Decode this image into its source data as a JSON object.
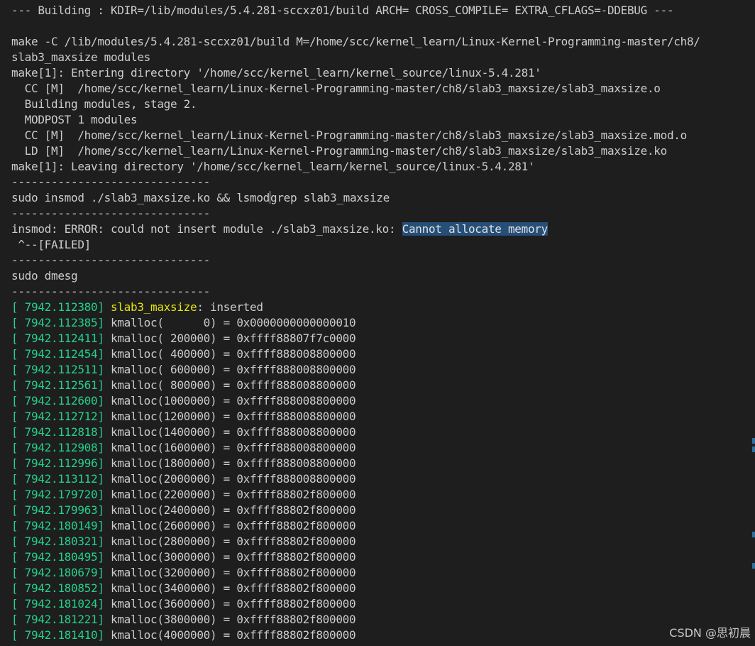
{
  "terminal": {
    "build_header": "--- Building : KDIR=/lib/modules/5.4.281-sccxz01/build ARCH= CROSS_COMPILE= EXTRA_CFLAGS=-DDEBUG ---",
    "make_cmd_1": "make -C /lib/modules/5.4.281-sccxz01/build M=/home/scc/kernel_learn/Linux-Kernel-Programming-master/ch8/",
    "make_cmd_2": "slab3_maxsize modules",
    "make_enter": "make[1]: Entering directory '/home/scc/kernel_learn/kernel_source/linux-5.4.281'",
    "cc_1": "  CC [M]  /home/scc/kernel_learn/Linux-Kernel-Programming-master/ch8/slab3_maxsize/slab3_maxsize.o",
    "building_stage": "  Building modules, stage 2.",
    "modpost": "  MODPOST 1 modules",
    "cc_2": "  CC [M]  /home/scc/kernel_learn/Linux-Kernel-Programming-master/ch8/slab3_maxsize/slab3_maxsize.mod.o",
    "ld": "  LD [M]  /home/scc/kernel_learn/Linux-Kernel-Programming-master/ch8/slab3_maxsize/slab3_maxsize.ko",
    "make_leave": "make[1]: Leaving directory '/home/scc/kernel_learn/kernel_source/linux-5.4.281'",
    "separator": "------------------------------",
    "insmod_cmd_a": "sudo insmod ./slab3_maxsize.ko && lsmod",
    "insmod_cmd_b": "grep slab3_maxsize",
    "error_prefix": "insmod: ERROR: could not insert module ./slab3_maxsize.ko: ",
    "error_highlight": "Cannot allocate memory",
    "failed": " ^--[FAILED]",
    "dmesg_cmd": "sudo dmesg",
    "module_name": "slab3_maxsize",
    "inserted_suffix": ": inserted",
    "dmesg_first_ts": "[ 7942.112380]",
    "dmesg_entries": [
      {
        "ts": "[ 7942.112385]",
        "msg": "kmalloc(      0) = 0x0000000000000010"
      },
      {
        "ts": "[ 7942.112411]",
        "msg": "kmalloc( 200000) = 0xffff88807f7c0000"
      },
      {
        "ts": "[ 7942.112454]",
        "msg": "kmalloc( 400000) = 0xffff888008800000"
      },
      {
        "ts": "[ 7942.112511]",
        "msg": "kmalloc( 600000) = 0xffff888008800000"
      },
      {
        "ts": "[ 7942.112561]",
        "msg": "kmalloc( 800000) = 0xffff888008800000"
      },
      {
        "ts": "[ 7942.112600]",
        "msg": "kmalloc(1000000) = 0xffff888008800000"
      },
      {
        "ts": "[ 7942.112712]",
        "msg": "kmalloc(1200000) = 0xffff888008800000"
      },
      {
        "ts": "[ 7942.112818]",
        "msg": "kmalloc(1400000) = 0xffff888008800000"
      },
      {
        "ts": "[ 7942.112908]",
        "msg": "kmalloc(1600000) = 0xffff888008800000"
      },
      {
        "ts": "[ 7942.112996]",
        "msg": "kmalloc(1800000) = 0xffff888008800000"
      },
      {
        "ts": "[ 7942.113112]",
        "msg": "kmalloc(2000000) = 0xffff888008800000"
      },
      {
        "ts": "[ 7942.179720]",
        "msg": "kmalloc(2200000) = 0xffff88802f800000"
      },
      {
        "ts": "[ 7942.179963]",
        "msg": "kmalloc(2400000) = 0xffff88802f800000"
      },
      {
        "ts": "[ 7942.180149]",
        "msg": "kmalloc(2600000) = 0xffff88802f800000"
      },
      {
        "ts": "[ 7942.180321]",
        "msg": "kmalloc(2800000) = 0xffff88802f800000"
      },
      {
        "ts": "[ 7942.180495]",
        "msg": "kmalloc(3000000) = 0xffff88802f800000"
      },
      {
        "ts": "[ 7942.180679]",
        "msg": "kmalloc(3200000) = 0xffff88802f800000"
      },
      {
        "ts": "[ 7942.180852]",
        "msg": "kmalloc(3400000) = 0xffff88802f800000"
      },
      {
        "ts": "[ 7942.181024]",
        "msg": "kmalloc(3600000) = 0xffff88802f800000"
      },
      {
        "ts": "[ 7942.181221]",
        "msg": "kmalloc(3800000) = 0xffff88802f800000"
      },
      {
        "ts": "[ 7942.181410]",
        "msg": "kmalloc(4000000) = 0xffff88802f800000"
      }
    ]
  },
  "watermark": "CSDN @思初晨",
  "colors": {
    "background": "#1e1e1e",
    "foreground": "#cccccc",
    "timestamp": "#23d18b",
    "module_name": "#e5e510",
    "selection": "#264f78"
  }
}
